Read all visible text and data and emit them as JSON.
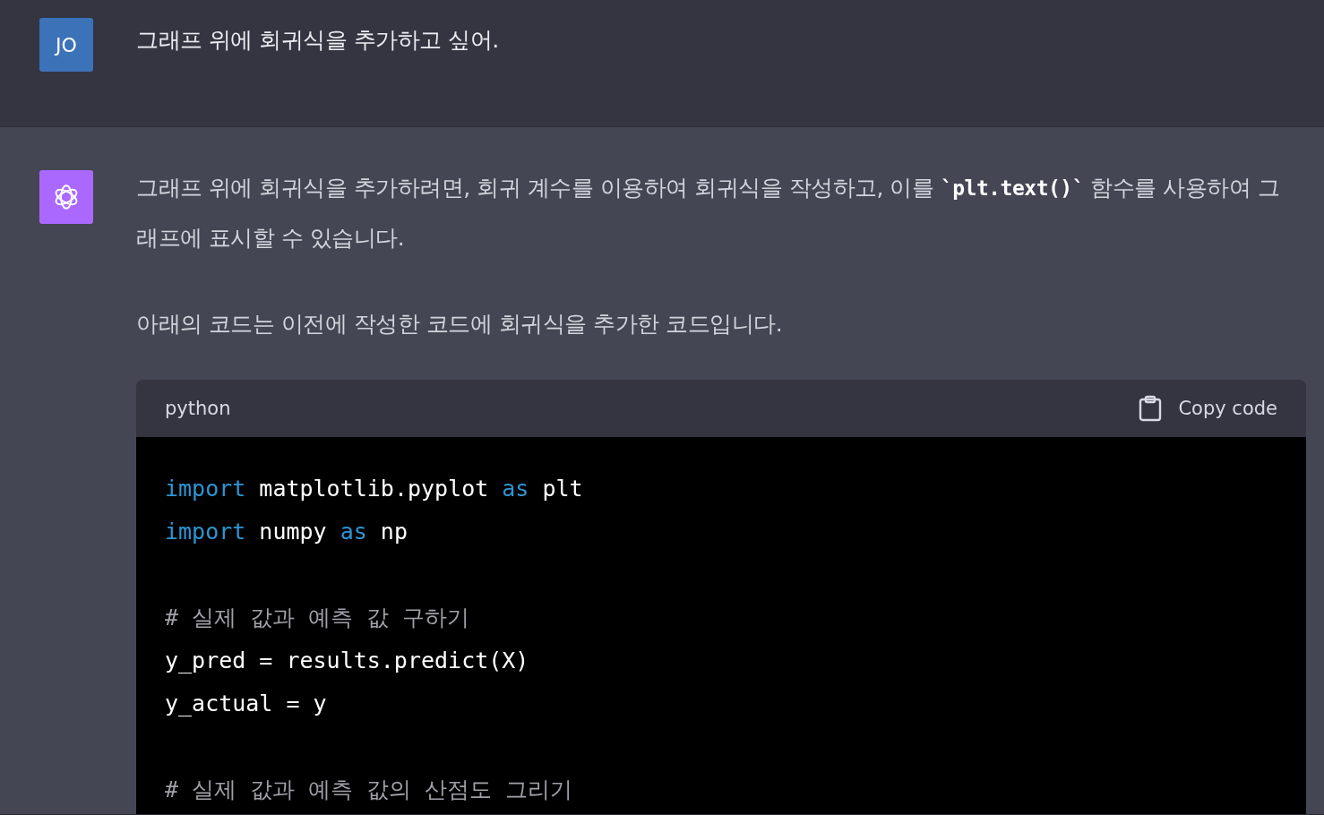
{
  "messages": [
    {
      "kind": "user",
      "avatar": "JO",
      "paragraphs": [
        [
          {
            "kind": "text",
            "text": "그래프 위에 회귀식을 추가하고 싶어."
          }
        ]
      ]
    },
    {
      "kind": "assistant",
      "paragraphs": [
        [
          {
            "kind": "text",
            "text": "그래프 위에 회귀식을 추가하려면, 회귀 계수를 이용하여 회귀식을 작성하고, 이를 "
          },
          {
            "kind": "code",
            "text": "`plt.text()`"
          },
          {
            "kind": "text",
            "text": " 함수를 사용하여 그래프에 표시할 수 있습니다."
          }
        ],
        [
          {
            "kind": "text",
            "text": "아래의 코드는 이전에 작성한 코드에 회귀식을 추가한 코드입니다."
          }
        ]
      ],
      "code_block": {
        "language": "python",
        "copy_label": "Copy code",
        "lines": [
          {
            "kind": "code",
            "tokens": [
              {
                "kind": "keyword",
                "text": "import"
              },
              {
                "kind": "plain",
                "text": " matplotlib.pyplot "
              },
              {
                "kind": "keyword",
                "text": "as"
              },
              {
                "kind": "plain",
                "text": " plt"
              }
            ]
          },
          {
            "kind": "code",
            "tokens": [
              {
                "kind": "keyword",
                "text": "import"
              },
              {
                "kind": "plain",
                "text": " numpy "
              },
              {
                "kind": "keyword",
                "text": "as"
              },
              {
                "kind": "plain",
                "text": " np"
              }
            ]
          },
          {
            "kind": "blank"
          },
          {
            "kind": "code",
            "tokens": [
              {
                "kind": "comment",
                "text": "# 실제 값과 예측 값 구하기"
              }
            ]
          },
          {
            "kind": "code",
            "tokens": [
              {
                "kind": "plain",
                "text": "y_pred = results.predict(X)"
              }
            ]
          },
          {
            "kind": "code",
            "tokens": [
              {
                "kind": "plain",
                "text": "y_actual = y"
              }
            ]
          },
          {
            "kind": "blank"
          },
          {
            "kind": "code",
            "tokens": [
              {
                "kind": "comment",
                "text": "# 실제 값과 예측 값의 산점도 그리기"
              }
            ]
          }
        ]
      }
    }
  ]
}
